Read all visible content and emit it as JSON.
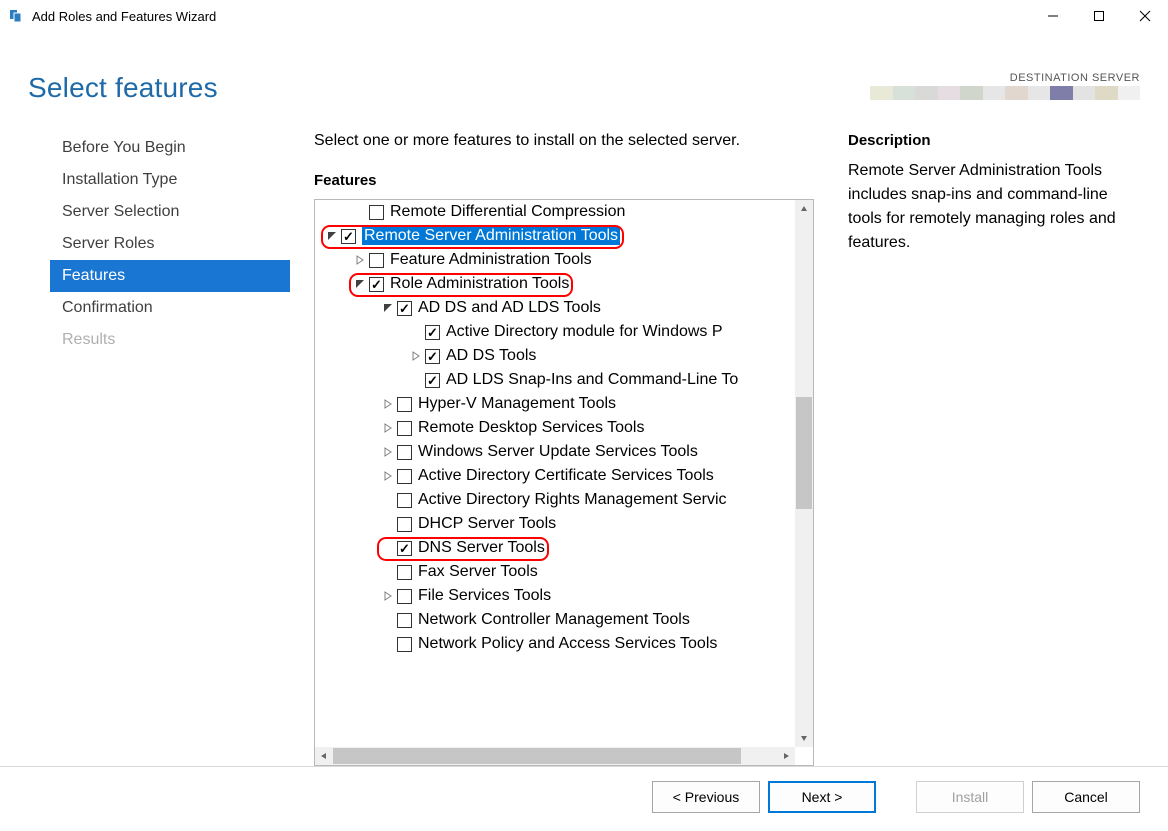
{
  "window": {
    "title": "Add Roles and Features Wizard"
  },
  "page_title": "Select features",
  "destination_label": "DESTINATION SERVER",
  "nav": {
    "items": [
      {
        "label": "Before You Begin",
        "state": "normal"
      },
      {
        "label": "Installation Type",
        "state": "normal"
      },
      {
        "label": "Server Selection",
        "state": "normal"
      },
      {
        "label": "Server Roles",
        "state": "normal"
      },
      {
        "label": "Features",
        "state": "selected"
      },
      {
        "label": "Confirmation",
        "state": "normal"
      },
      {
        "label": "Results",
        "state": "disabled"
      }
    ]
  },
  "instruction": "Select one or more features to install on the selected server.",
  "features_label": "Features",
  "description_label": "Description",
  "description_text": "Remote Server Administration Tools includes snap-ins and command-line tools for remotely managing roles and features.",
  "tree": [
    {
      "indent": 1,
      "expander": "none",
      "checked": false,
      "label": "Remote Differential Compression",
      "selected": false,
      "highlight": false
    },
    {
      "indent": 0,
      "expander": "open",
      "checked": true,
      "label": "Remote Server Administration Tools",
      "selected": true,
      "highlight": true
    },
    {
      "indent": 1,
      "expander": "closed",
      "checked": false,
      "label": "Feature Administration Tools",
      "selected": false,
      "highlight": false
    },
    {
      "indent": 1,
      "expander": "open",
      "checked": true,
      "label": "Role Administration Tools",
      "selected": false,
      "highlight": true
    },
    {
      "indent": 2,
      "expander": "open",
      "checked": true,
      "label": "AD DS and AD LDS Tools",
      "selected": false,
      "highlight": false
    },
    {
      "indent": 3,
      "expander": "none",
      "checked": true,
      "label": "Active Directory module for Windows P",
      "selected": false,
      "highlight": false
    },
    {
      "indent": 3,
      "expander": "closed",
      "checked": true,
      "label": "AD DS Tools",
      "selected": false,
      "highlight": false
    },
    {
      "indent": 3,
      "expander": "none",
      "checked": true,
      "label": "AD LDS Snap-Ins and Command-Line To",
      "selected": false,
      "highlight": false
    },
    {
      "indent": 2,
      "expander": "closed",
      "checked": false,
      "label": "Hyper-V Management Tools",
      "selected": false,
      "highlight": false
    },
    {
      "indent": 2,
      "expander": "closed",
      "checked": false,
      "label": "Remote Desktop Services Tools",
      "selected": false,
      "highlight": false
    },
    {
      "indent": 2,
      "expander": "closed",
      "checked": false,
      "label": "Windows Server Update Services Tools",
      "selected": false,
      "highlight": false
    },
    {
      "indent": 2,
      "expander": "closed",
      "checked": false,
      "label": "Active Directory Certificate Services Tools",
      "selected": false,
      "highlight": false
    },
    {
      "indent": 2,
      "expander": "none",
      "checked": false,
      "label": "Active Directory Rights Management Servic",
      "selected": false,
      "highlight": false
    },
    {
      "indent": 2,
      "expander": "none",
      "checked": false,
      "label": "DHCP Server Tools",
      "selected": false,
      "highlight": false
    },
    {
      "indent": 2,
      "expander": "none",
      "checked": true,
      "label": "DNS Server Tools",
      "selected": false,
      "highlight": true
    },
    {
      "indent": 2,
      "expander": "none",
      "checked": false,
      "label": "Fax Server Tools",
      "selected": false,
      "highlight": false
    },
    {
      "indent": 2,
      "expander": "closed",
      "checked": false,
      "label": "File Services Tools",
      "selected": false,
      "highlight": false
    },
    {
      "indent": 2,
      "expander": "none",
      "checked": false,
      "label": "Network Controller Management Tools",
      "selected": false,
      "highlight": false
    },
    {
      "indent": 2,
      "expander": "none",
      "checked": false,
      "label": "Network Policy and Access Services Tools",
      "selected": false,
      "highlight": false
    }
  ],
  "buttons": {
    "previous": "< Previous",
    "next": "Next >",
    "install": "Install",
    "cancel": "Cancel"
  },
  "stripe_colors": [
    "#e9e9d8",
    "#d8e0da",
    "#d9d9d8",
    "#e6dde3",
    "#d0d6cb",
    "#e6e6e6",
    "#e2d7ce",
    "#e6e6e6",
    "#7e7ea8",
    "#e3e3e3",
    "#dedac6",
    "#f0f0f0"
  ]
}
